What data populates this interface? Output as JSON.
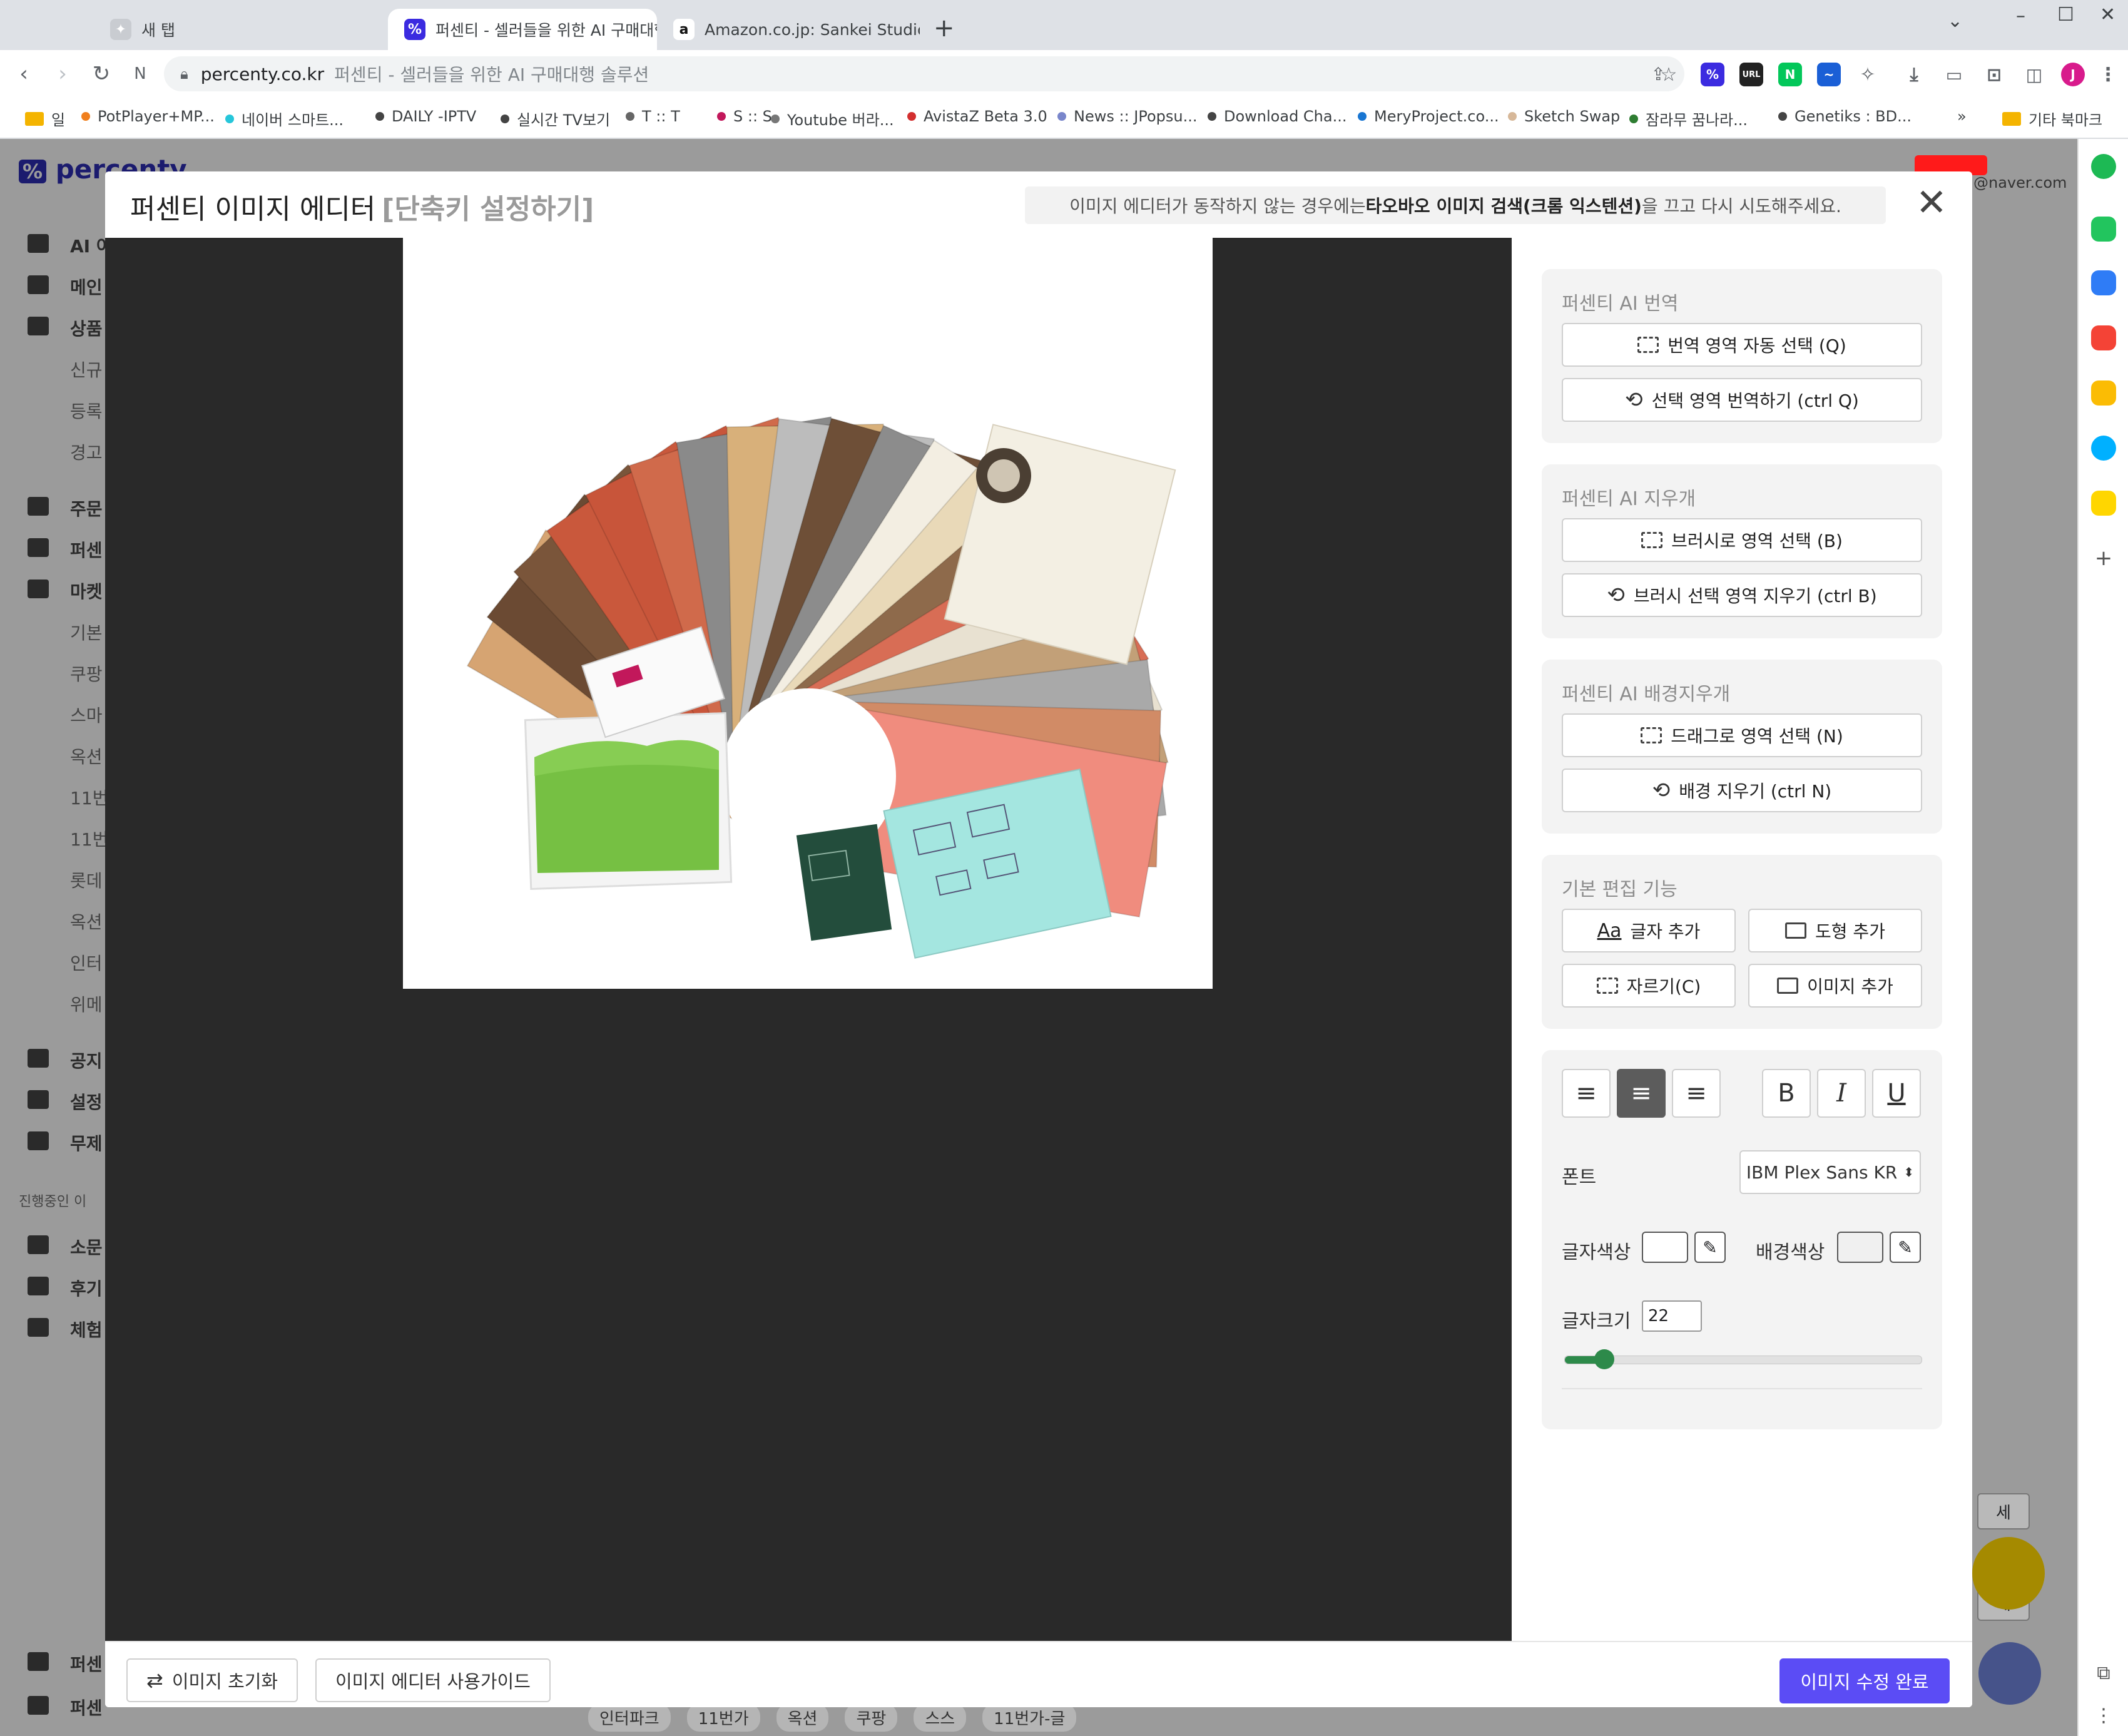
{
  "tabs": [
    {
      "title": "새 탭",
      "icon": "bird-icon"
    },
    {
      "title": "퍼센티 - 셀러들을 위한 AI 구매대행 솔루션",
      "icon": "percenty-icon",
      "active": true
    },
    {
      "title": "Amazon.co.jp: Sankei Studio Ghibli",
      "icon": "amazon-icon"
    }
  ],
  "new_tab": "+",
  "address": {
    "host": "percenty.co.kr",
    "page_title": "퍼센티 - 셀러들을 위한 AI 구매대행 솔루션"
  },
  "extensions": [
    {
      "name": "percenty-ext-icon",
      "label": "%",
      "color": "#3b2be0"
    },
    {
      "name": "url-ext-icon",
      "label": "URL",
      "color": "#222222"
    },
    {
      "name": "naver-ext-icon",
      "label": "N",
      "color": "#03c75a"
    },
    {
      "name": "wave-ext-icon",
      "label": "~",
      "color": "#1a5fd6"
    }
  ],
  "profile_initial": "J",
  "bookmarks": [
    {
      "label": "일",
      "dot": "#f4b400",
      "folder": true
    },
    {
      "label": "PotPlayer+MP...",
      "dot": "#f07f1d"
    },
    {
      "label": "네이버 스마트...",
      "dot": "#26c6da"
    },
    {
      "label": "DAILY -IPTV",
      "dot": "#444444"
    },
    {
      "label": "실시간 TV보기",
      "dot": "#444444"
    },
    {
      "label": "T :: T",
      "dot": "#666666"
    },
    {
      "label": "S :: S",
      "dot": "#c2185b"
    },
    {
      "label": "Youtube 버라...",
      "dot": "#777777"
    },
    {
      "label": "AvistaZ Beta 3.0",
      "dot": "#d32f2f"
    },
    {
      "label": "News :: JPopsu...",
      "dot": "#7986cb"
    },
    {
      "label": "Download Cha...",
      "dot": "#444444"
    },
    {
      "label": "MeryProject.co...",
      "dot": "#1976d2"
    },
    {
      "label": "Sketch Swap",
      "dot": "#d7b899"
    },
    {
      "label": "잠라무 꿈나라...",
      "dot": "#2e7d32"
    },
    {
      "label": "Genetiks : BD...",
      "dot": "#444444"
    }
  ],
  "bookmarks_more": "»",
  "other_bookmarks": "기타 북마크",
  "background_page": {
    "logo": "percenty",
    "email_fragment": "@naver.com",
    "sidebar": [
      "AI 어",
      "메인",
      "상품",
      "신규",
      "등록",
      "경고",
      "주문",
      "퍼센",
      "마켓",
      "기본",
      "쿠팡",
      "스마",
      "옥션",
      "11번",
      "11번",
      "롯데",
      "옥션",
      "인터",
      "위메",
      "공지",
      "설정",
      "무제",
      "진행중인 이",
      "소문",
      "후기",
      "체험",
      "퍼센",
      "퍼센"
    ],
    "bottom_tags": [
      "인터파크",
      "11번가",
      "옥션",
      "쿠팡",
      "스스",
      "11번가-글"
    ],
    "side_btn": "세"
  },
  "modal": {
    "title": "퍼센티 이미지 에디터",
    "shortcut_link": "[단축키 설정하기]",
    "notice_pre": "이미지 에디터가 동작하지 않는 경우에는 ",
    "notice_bold": "타오바오 이미지 검색(크롬 익스텐션)",
    "notice_post": "을 끄고 다시 시도해주세요.",
    "close_icon": "✕"
  },
  "panel": {
    "translate": {
      "heading": "퍼센티 AI 번역",
      "auto_select": "번역 영역 자동 선택 (Q)",
      "translate_selected": "선택 영역 번역하기 (ctrl Q)"
    },
    "eraser": {
      "heading": "퍼센티 AI 지우개",
      "brush_select": "브러시로 영역 선택 (B)",
      "brush_erase": "브러시 선택 영역 지우기 (ctrl B)"
    },
    "bg_remove": {
      "heading": "퍼센티 AI 배경지우개",
      "drag_select": "드래그로 영역 선택 (N)",
      "bg_erase": "배경 지우기 (ctrl N)"
    },
    "basic": {
      "heading": "기본 편집 기능",
      "add_text": "글자 추가",
      "add_shape": "도형 추가",
      "crop": "자르기(C)",
      "add_image": "이미지 추가"
    },
    "text": {
      "bold": "B",
      "italic": "I",
      "underline": "U",
      "font_label": "폰트",
      "font_value": "IBM Plex Sans KR",
      "text_color_label": "글자색상",
      "bg_color_label": "배경색상",
      "size_label": "글자크기",
      "size_value": "22",
      "size_fraction": 0.11
    }
  },
  "footer": {
    "reset": "이미지 초기화",
    "guide": "이미지 에디터 사용가이드",
    "done": "이미지 수정 완료"
  },
  "colors": {
    "accent": "#5b4cf5",
    "slider": "#2d8a4a",
    "canvas_bg": "#292929"
  },
  "photo": {
    "subject": "papercraft model kit sheets fanned out with a bag of green flock"
  }
}
